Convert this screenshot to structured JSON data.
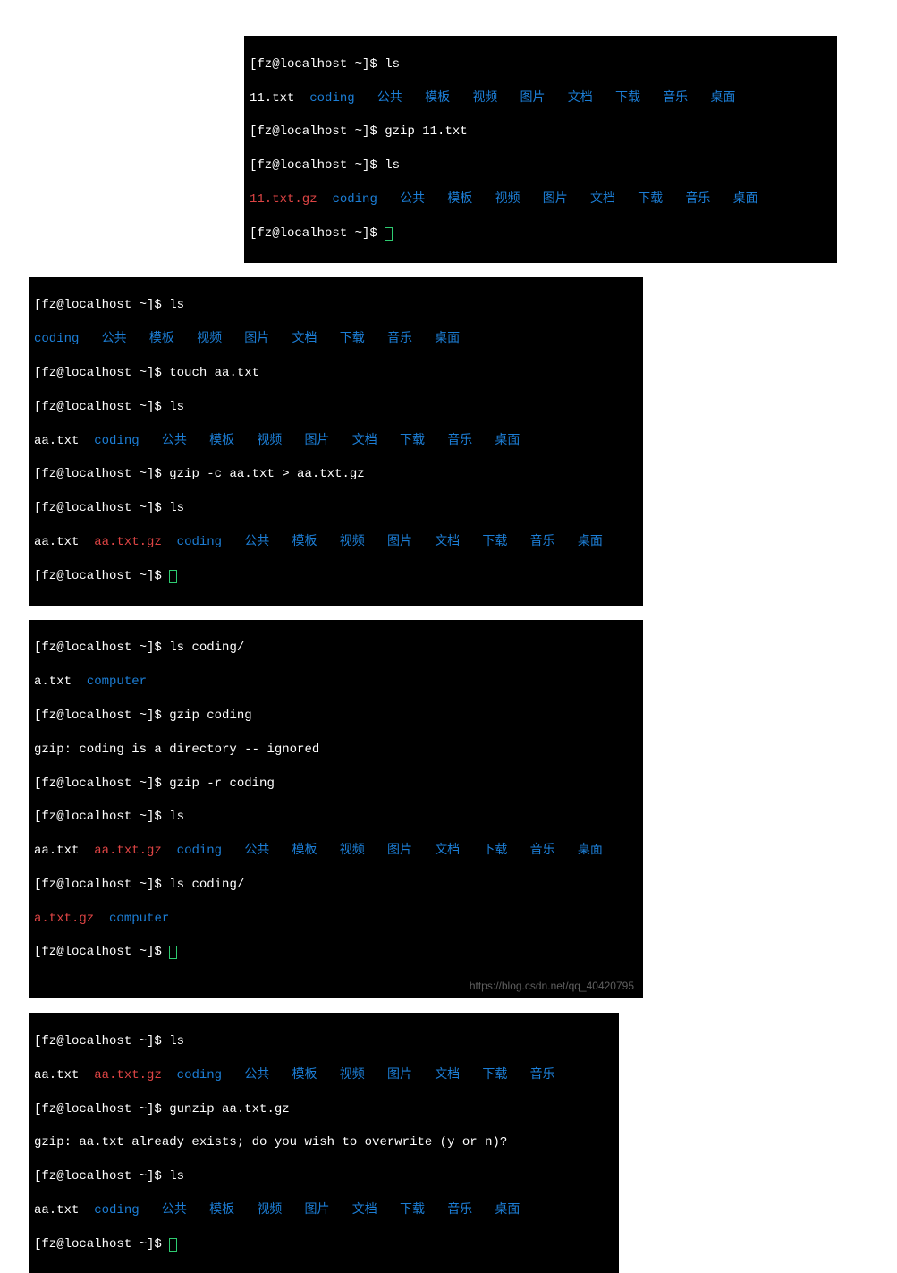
{
  "prompt": "[fz@localhost ~]$ ",
  "dirs": {
    "coding": "coding",
    "gonggong": "公共",
    "muban": "模板",
    "shipin": "视频",
    "tupian": "图片",
    "wendang": "文档",
    "xiazai": "下载",
    "yinyue": "音乐",
    "zhuomian": "桌面",
    "computer": "computer"
  },
  "files": {
    "t11": "11.txt",
    "t11gz": "11.txt.gz",
    "aa": "aa.txt",
    "aagz": "aa.txt.gz",
    "atxt": "a.txt",
    "atxtgz": "a.txt.gz"
  },
  "cmds": {
    "ls": "ls",
    "gzip11": "gzip 11.txt",
    "touchaa": "touch aa.txt",
    "gzipc": "gzip -c aa.txt > aa.txt.gz",
    "lscoding": "ls coding/",
    "gzipcoding": "gzip coding",
    "gzipr": "gzip -r coding",
    "gunzip": "gunzip aa.txt.gz"
  },
  "msgs": {
    "ignored": "gzip: coding is a directory -- ignored",
    "overwrite": "gzip: aa.txt already exists; do you wish to overwrite (y or n)?"
  },
  "watermark": "https://blog.csdn.net/qq_40420795",
  "sp": "  ",
  "sp3": "   "
}
